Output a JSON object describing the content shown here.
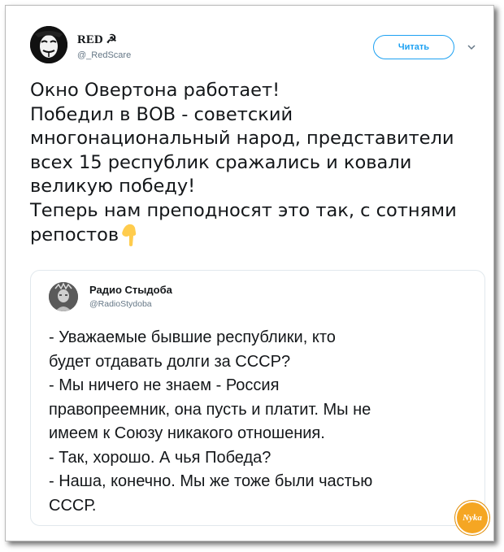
{
  "tweet": {
    "user_name": "RED ☭",
    "user_handle": "@_RedScare",
    "follow_label": "Читать",
    "lines": [
      "Окно Овертона работает!",
      "Победил в ВОВ - советский",
      "многонациональный народ, представители",
      "всех 15 республик сражались и ковали",
      "великую победу!",
      "Теперь нам преподносят это так, с сотнями",
      "репостов"
    ]
  },
  "quote": {
    "user_name": "Радио Стыдоба",
    "user_handle": "@RadioStydoba",
    "lines": [
      "- Уважаемые бывшие республики, кто",
      "будет отдавать долги за СССР?",
      "- Мы ничего не знаем - Россия",
      "правопреемник, она пусть и платит. Мы не",
      "имеем к Союзу никакого отношения.",
      "- Так, хорошо. А чья Победа?",
      "- Наша, конечно. Мы же тоже были частью",
      "СССР."
    ]
  },
  "watermark": {
    "text": "Nyka"
  },
  "icons": {
    "avatar": "guy-fawkes-mask-avatar",
    "caret": "chevron-down-icon",
    "emoji": "pointing-down-hand-emoji",
    "quote_avatar": "statue-avatar"
  },
  "colors": {
    "accent": "#1da1f2",
    "text": "#14171a",
    "muted": "#657786"
  }
}
